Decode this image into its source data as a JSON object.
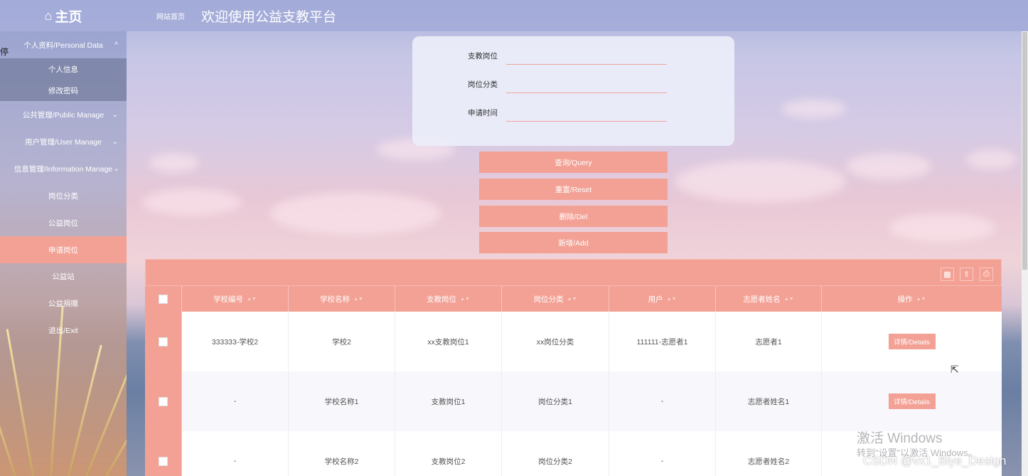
{
  "header": {
    "brand_icon": "home-icon",
    "brand_label": "主页",
    "nav_home": "网站首页",
    "title": "欢迎使用公益支教平台"
  },
  "sidebar": {
    "stray_char": "停",
    "items": [
      {
        "label": "个人资料/Personal Data",
        "chevron": "^"
      },
      {
        "label": "个人信息"
      },
      {
        "label": "修改密码"
      },
      {
        "label": "公共管理/Public Manage",
        "chevron": "⌄"
      },
      {
        "label": "用户管理/User Manage",
        "chevron": "⌄"
      },
      {
        "label": "信息管理/Information Manage",
        "chevron": "⌄"
      },
      {
        "label": "岗位分类"
      },
      {
        "label": "公益岗位"
      },
      {
        "label": "申请岗位"
      },
      {
        "label": "公益站"
      },
      {
        "label": "公益捐赠"
      },
      {
        "label": "退出/Exit"
      }
    ]
  },
  "search": {
    "fields": [
      {
        "label": "支教岗位",
        "value": ""
      },
      {
        "label": "岗位分类",
        "value": ""
      },
      {
        "label": "申请时间",
        "value": ""
      }
    ]
  },
  "actions": {
    "query": "查询/Query",
    "reset": "重置/Reset",
    "delete": "删除/Del",
    "add": "新增/Add"
  },
  "table": {
    "toolbar_icons": [
      "grid-icon",
      "export-icon",
      "print-icon"
    ],
    "columns": [
      "学校编号",
      "学校名称",
      "支教岗位",
      "岗位分类",
      "用户",
      "志愿者姓名",
      "操作"
    ],
    "rows": [
      {
        "school_id": "333333-学校2",
        "school_name": "学校2",
        "post": "xx支教岗位1",
        "category": "xx岗位分类",
        "user": "111111-志愿者1",
        "volunteer": "志愿者1",
        "action": "详情/Details"
      },
      {
        "school_id": "-",
        "school_name": "学校名称1",
        "post": "支教岗位1",
        "category": "岗位分类1",
        "user": "-",
        "volunteer": "志愿者姓名1",
        "action": "详情/Details"
      },
      {
        "school_id": "-",
        "school_name": "学校名称2",
        "post": "支教岗位2",
        "category": "岗位分类2",
        "user": "-",
        "volunteer": "志愿者姓名2",
        "action": ""
      }
    ]
  },
  "watermark": {
    "activate": "激活 Windows",
    "activate_sub": "转到\"设置\"以激活 Windows。",
    "csdn": "CSDN @vx1_Biye_Design"
  }
}
